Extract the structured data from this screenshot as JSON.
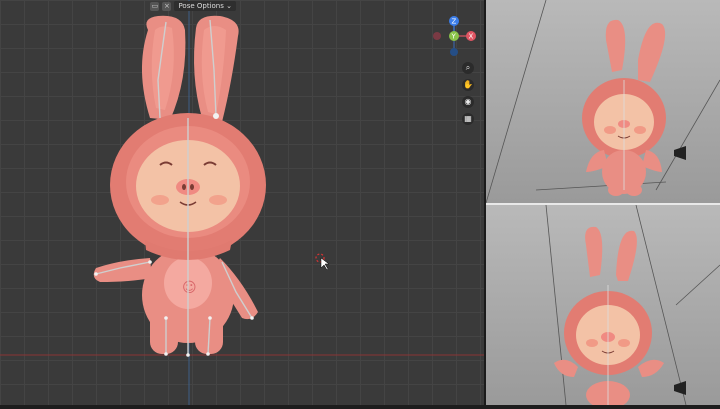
{
  "header": {
    "pose_options_label": "Pose Options",
    "pose_options_chevron": "chevron-down-icon",
    "display_icon": "display-toggle-icon",
    "close_icon": "close-icon"
  },
  "gizmo": {
    "axis_z": "Z",
    "axis_x": "X",
    "axis_y": "Y",
    "colors": {
      "x": "#e05563",
      "y": "#8bc34a",
      "z": "#3b7de9"
    }
  },
  "nav_tools": [
    "zoom-icon",
    "hand-pan-icon",
    "camera-icon",
    "grid-icon"
  ],
  "colors": {
    "character": "#e8867a",
    "skin": "#f2c0a4",
    "bone": "#cfcfcf"
  }
}
